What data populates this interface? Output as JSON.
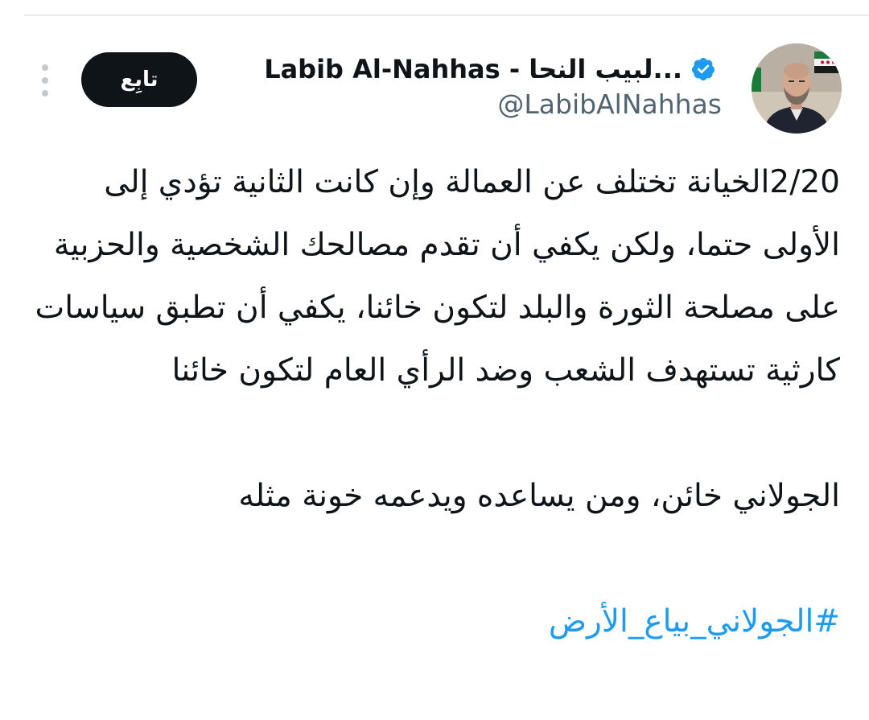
{
  "tweet": {
    "author": {
      "display_name": "Labib Al-Nahhas - لبيب النحا...",
      "handle": "@LabibAlNahhas",
      "verified": true,
      "verified_color": "#1d9bf0"
    },
    "follow_label": "تابِع",
    "more_icon": "more-vertical-icon",
    "thread_index": "2/20",
    "paragraph_1": "الخيانة تختلف عن العمالة وإن كانت الثانية تؤدي إلى الأولى حتما، ولكن يكفي أن تقدم مصالحك الشخصية والحزبية على مصلحة الثورة والبلد لتكون خائنا، يكفي أن تطبق سياسات كارثية تستهدف الشعب وضد الرأي العام لتكون خائنا",
    "paragraph_2": "الجولاني خائن، ومن يساعده ويدعمه خونة مثله",
    "hashtag": "#الجولاني_بياع_الأرض",
    "colors": {
      "text": "#0f1419",
      "secondary": "#536471",
      "link": "#1d9bf0",
      "button_bg": "#0f1419"
    }
  }
}
